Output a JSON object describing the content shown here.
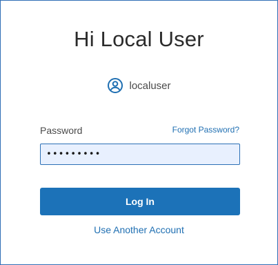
{
  "login": {
    "title": "Hi Local User",
    "username": "localuser",
    "password_label": "Password",
    "forgot_link": "Forgot Password?",
    "password_value": "•••••••••",
    "login_button": "Log In",
    "other_account_link": "Use Another Account"
  },
  "icons": {
    "user": "account-circle-icon"
  },
  "colors": {
    "accent": "#1c72b8",
    "link": "#1f6fb2",
    "input_bg": "#e8f0fe",
    "frame_border": "#2f6db5"
  }
}
